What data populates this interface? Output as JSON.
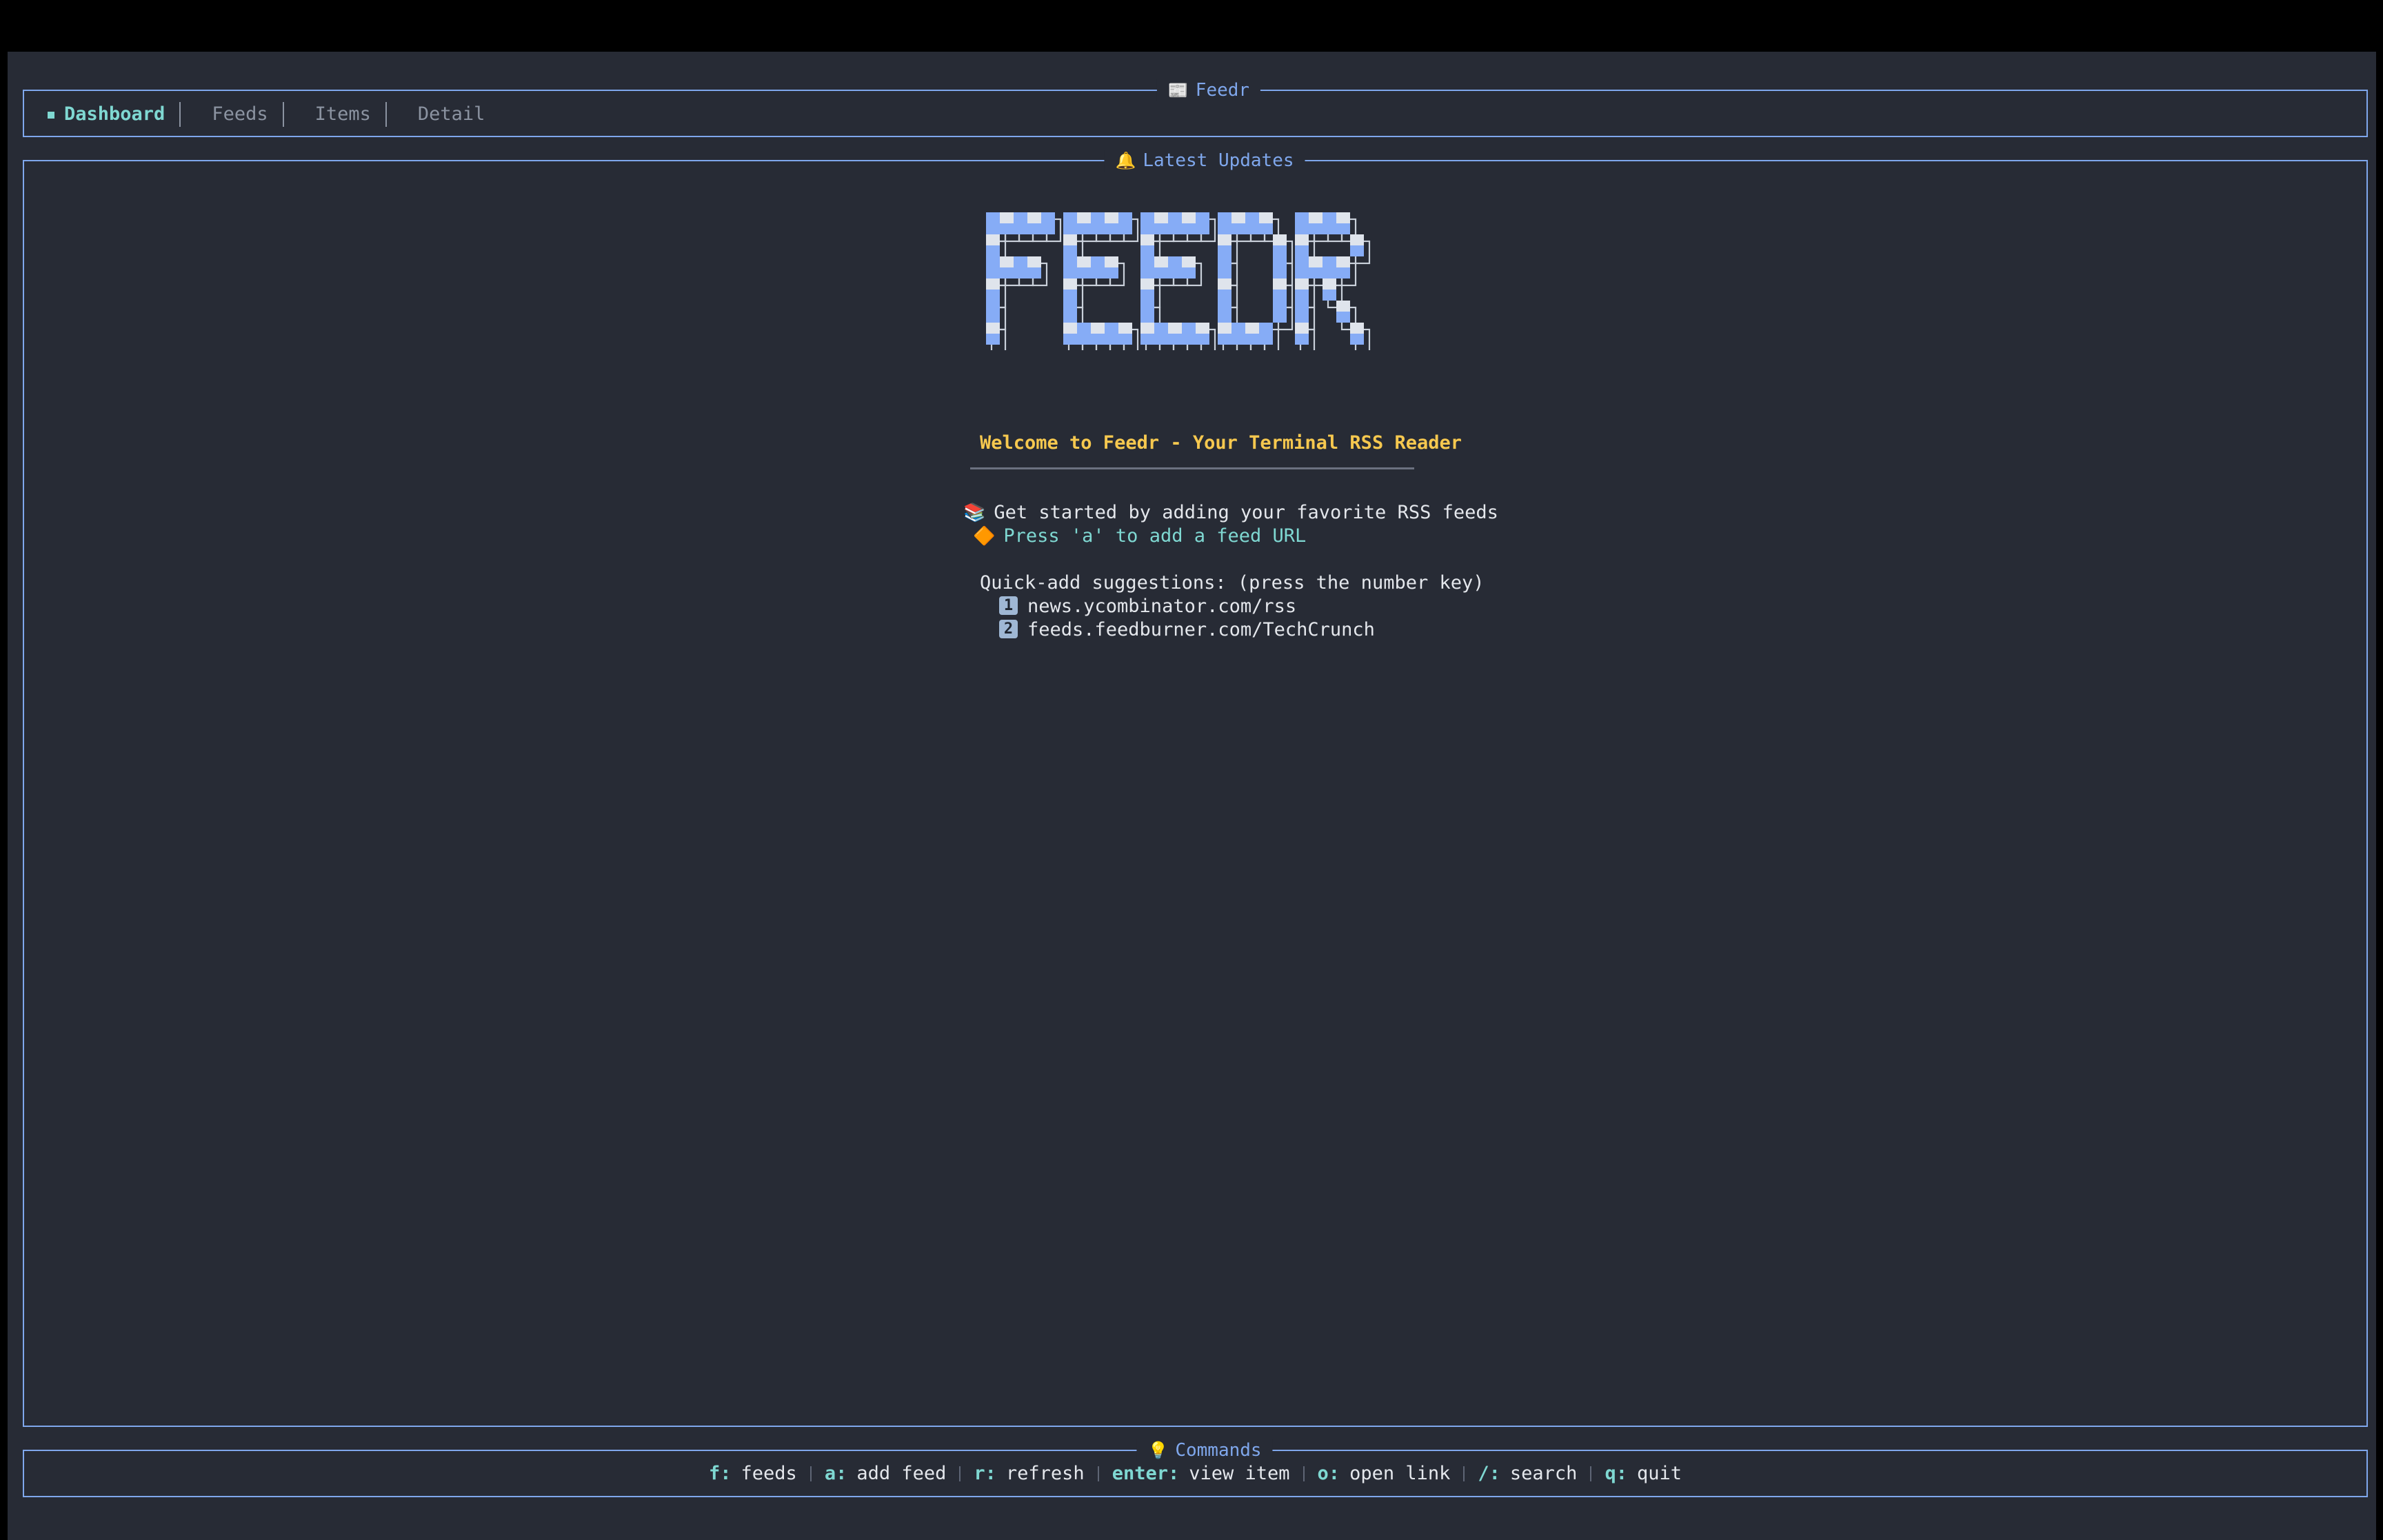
{
  "colors": {
    "background": "#272b35",
    "border": "#7fa7ec",
    "accent": "#7fd8d2",
    "welcome": "#f6c84f",
    "text": "#e4e7ec",
    "muted": "#8b93a1"
  },
  "header": {
    "title_icon": "📰",
    "title": "Feedr",
    "tabs": [
      {
        "label": "Dashboard",
        "active": true
      },
      {
        "label": "Feeds",
        "active": false
      },
      {
        "label": "Items",
        "active": false
      },
      {
        "label": "Detail",
        "active": false
      }
    ]
  },
  "main": {
    "title_icon": "🔔",
    "title": "Latest Updates",
    "welcome": "Welcome to Feedr - Your Terminal RSS Reader",
    "get_started_icon": "📚",
    "get_started": "Get started by adding your favorite RSS feeds",
    "press_icon": "🔶",
    "press_hint": "Press 'a' to add a feed URL",
    "quick_add_label": "Quick-add suggestions: (press the number key)",
    "suggestions": [
      {
        "key": "1",
        "url": "news.ycombinator.com/rss"
      },
      {
        "key": "2",
        "url": "feeds.feedburner.com/TechCrunch"
      }
    ]
  },
  "commands": {
    "title_icon": "💡",
    "title": "Commands",
    "items": [
      {
        "key": "f:",
        "desc": "feeds"
      },
      {
        "key": "a:",
        "desc": "add feed"
      },
      {
        "key": "r:",
        "desc": "refresh"
      },
      {
        "key": "enter:",
        "desc": "view item"
      },
      {
        "key": "o:",
        "desc": "open link"
      },
      {
        "key": "/:",
        "desc": "search"
      },
      {
        "key": "q:",
        "desc": "quit"
      }
    ]
  }
}
